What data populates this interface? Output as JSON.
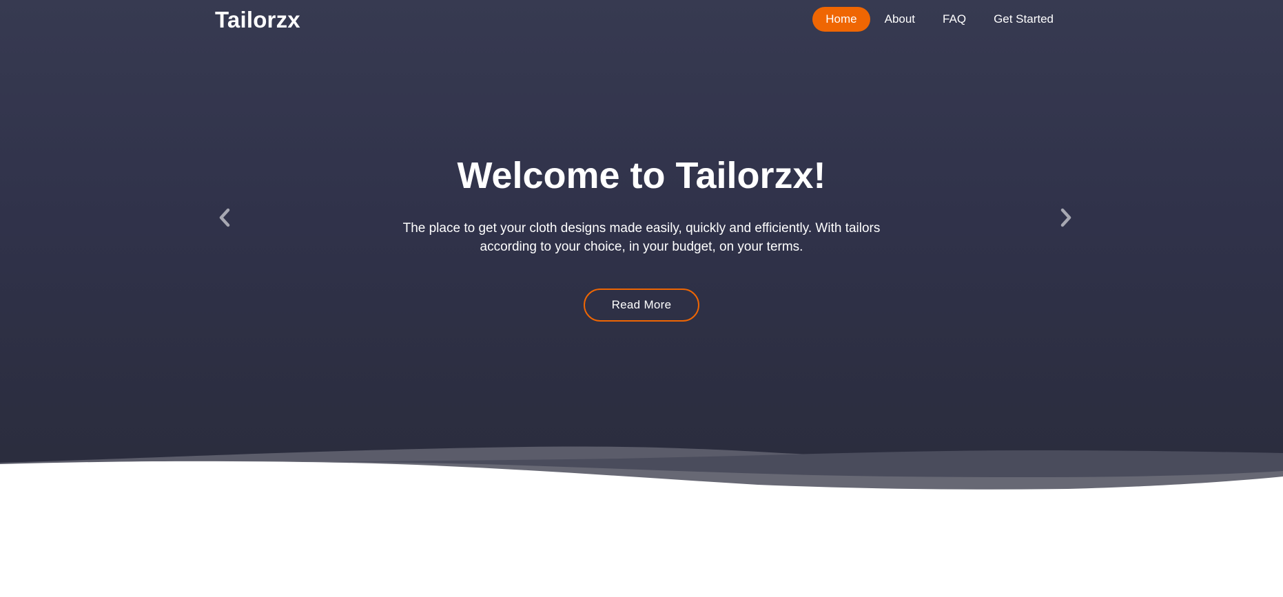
{
  "header": {
    "logo": "Tailorzx",
    "nav": [
      {
        "label": "Home",
        "active": true
      },
      {
        "label": "About",
        "active": false
      },
      {
        "label": "FAQ",
        "active": false
      },
      {
        "label": "Get Started",
        "active": false
      }
    ]
  },
  "hero": {
    "title": "Welcome to Tailorzx!",
    "text": "The place to get your cloth designs made easily, quickly and efficiently. With tailors according to your choice, in your budget, on your terms.",
    "button_label": "Read More"
  },
  "carousel": {
    "prev_icon": "chevron-left-icon",
    "next_icon": "chevron-right-icon"
  },
  "colors": {
    "accent": "#ef6603",
    "hero_top": "#373a51",
    "hero_bottom": "#2a2c3c"
  }
}
